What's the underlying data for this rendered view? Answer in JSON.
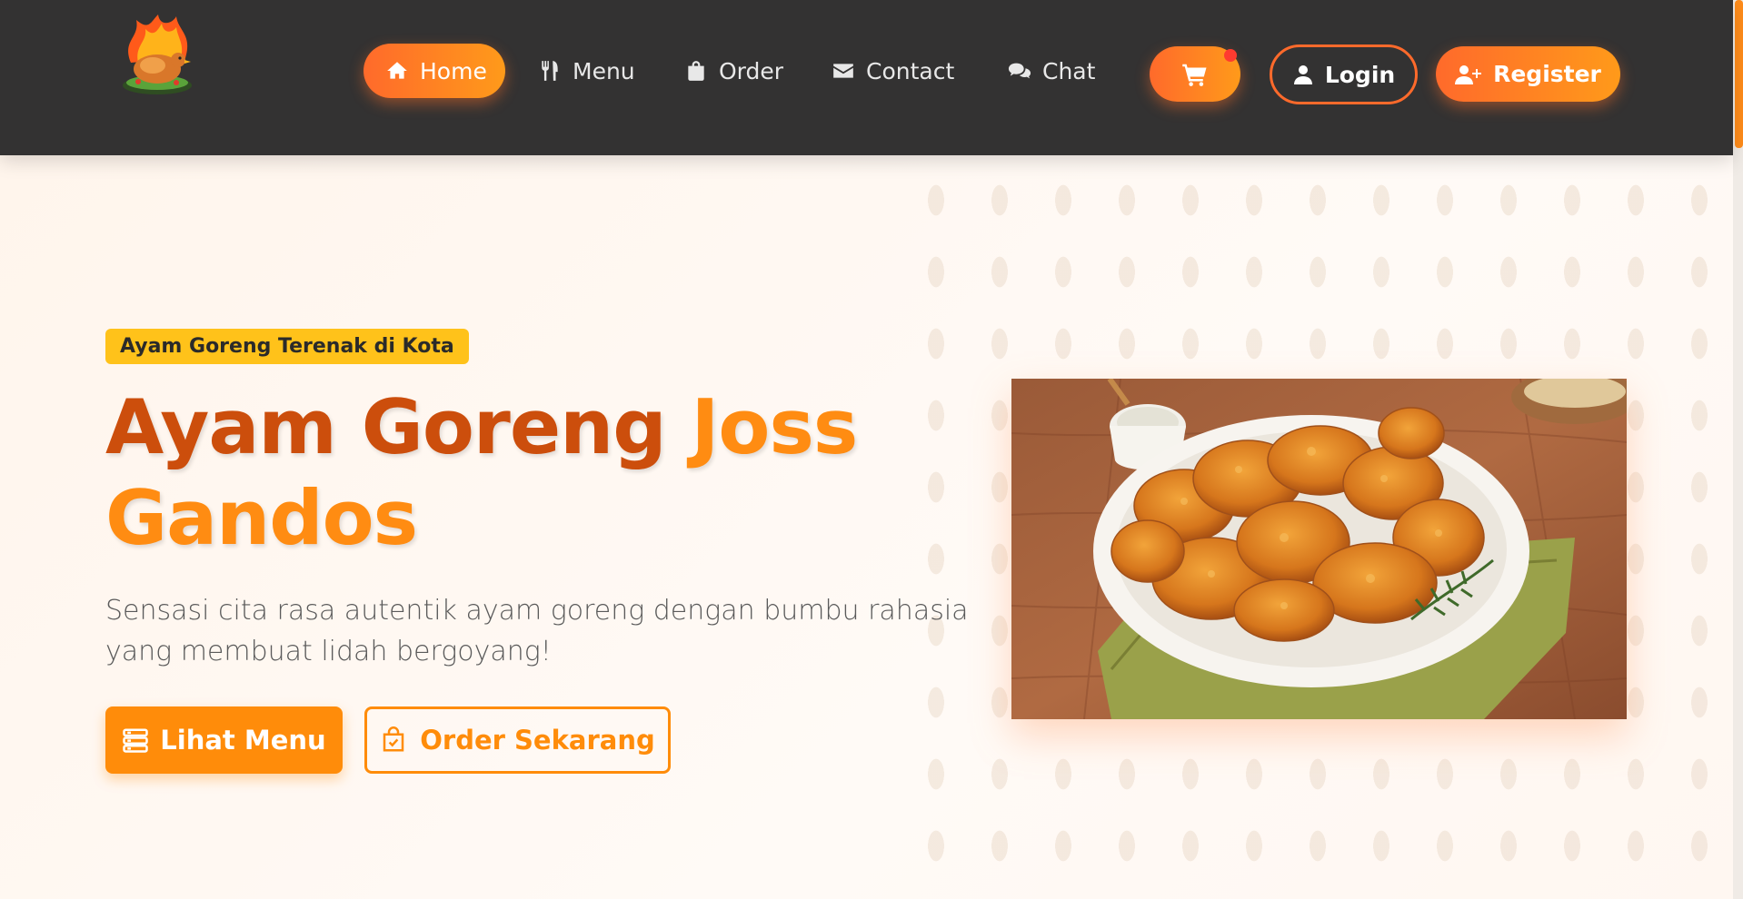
{
  "nav": {
    "logo_alt": "Ayam Goreng Joss Gandos logo",
    "items": [
      {
        "label": "Home",
        "icon": "home-icon",
        "active": true
      },
      {
        "label": "Menu",
        "icon": "utensils-icon"
      },
      {
        "label": "Order",
        "icon": "shopping-bag-icon"
      },
      {
        "label": "Contact",
        "icon": "envelope-icon"
      },
      {
        "label": "Chat",
        "icon": "chat-bubbles-icon"
      }
    ],
    "cart_icon": "cart-icon",
    "login_label": "Login",
    "register_label": "Register"
  },
  "hero": {
    "badge": "Ayam Goreng Terenak di Kota",
    "title_part1": "Ayam Goreng ",
    "title_part2": "Joss",
    "title_part3": "Gandos",
    "subtitle": "Sensasi cita rasa autentik ayam goreng dengan bumbu rahasia yang membuat lidah bergoyang!",
    "primary_button": "Lihat Menu",
    "secondary_button": "Order Sekarang",
    "image_alt": "Plate of fried chicken"
  },
  "colors": {
    "navbar_bg": "#333232",
    "accent_orange": "#ff8c0a",
    "accent_dark_orange": "#cc4e0c",
    "badge_yellow": "#ffc21a"
  }
}
